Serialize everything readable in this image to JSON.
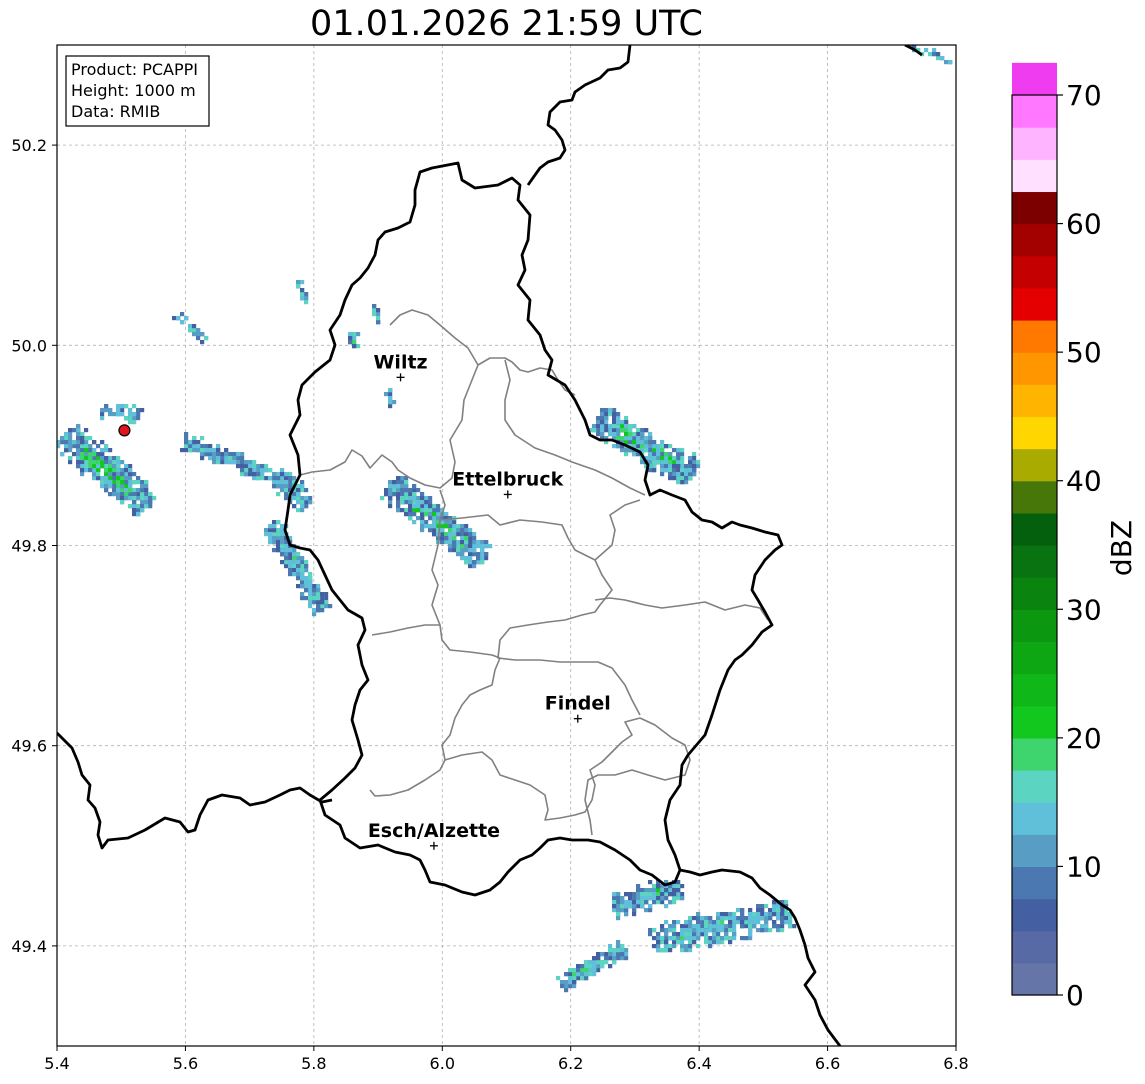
{
  "title": "01.01.2026 21:59 UTC",
  "info_box": [
    "Product: PCAPPI",
    "Height: 1000 m",
    "Data: RMIB"
  ],
  "axes": {
    "x_ticks": [
      "5.4",
      "5.6",
      "5.8",
      "6.0",
      "6.2",
      "6.4",
      "6.6",
      "6.8"
    ],
    "y_ticks": [
      "49.4",
      "49.6",
      "49.8",
      "50.0",
      "50.2"
    ],
    "x_range": [
      5.4,
      6.8
    ],
    "y_range": [
      49.3,
      50.3
    ],
    "grid": true
  },
  "cities": [
    {
      "name": "Wiltz",
      "lon": 5.935,
      "lat": 49.968
    },
    {
      "name": "Ettelbruck",
      "lon": 6.102,
      "lat": 49.851
    },
    {
      "name": "Findel",
      "lon": 6.211,
      "lat": 49.627
    },
    {
      "name": "Esch/Alzette",
      "lon": 5.987,
      "lat": 49.5
    }
  ],
  "radar_site": {
    "lon": 5.505,
    "lat": 49.915
  },
  "colorbar": {
    "label": "dBZ",
    "ticks": [
      "0",
      "10",
      "20",
      "30",
      "40",
      "50",
      "60",
      "70"
    ],
    "min": 0,
    "max": 70,
    "step": 2.5,
    "colors": [
      "#6575a8",
      "#586aa5",
      "#4460a2",
      "#4b78b0",
      "#589dc4",
      "#61c0d9",
      "#5bd4c1",
      "#3ed56e",
      "#12c71e",
      "#0fb818",
      "#0ea714",
      "#0c9711",
      "#0a840f",
      "#087310",
      "#05600d",
      "#477709",
      "#aaab00",
      "#ffd600",
      "#ffb400",
      "#ff9600",
      "#ff7800",
      "#e40000",
      "#c40000",
      "#a30000",
      "#7d0000",
      "#ffe0ff",
      "#ffb4ff",
      "#ff78ff",
      "#f03cf0"
    ]
  },
  "colors": {
    "grid": "#b0b0b0",
    "country_border": "#000000",
    "canton_border": "#808080"
  }
}
